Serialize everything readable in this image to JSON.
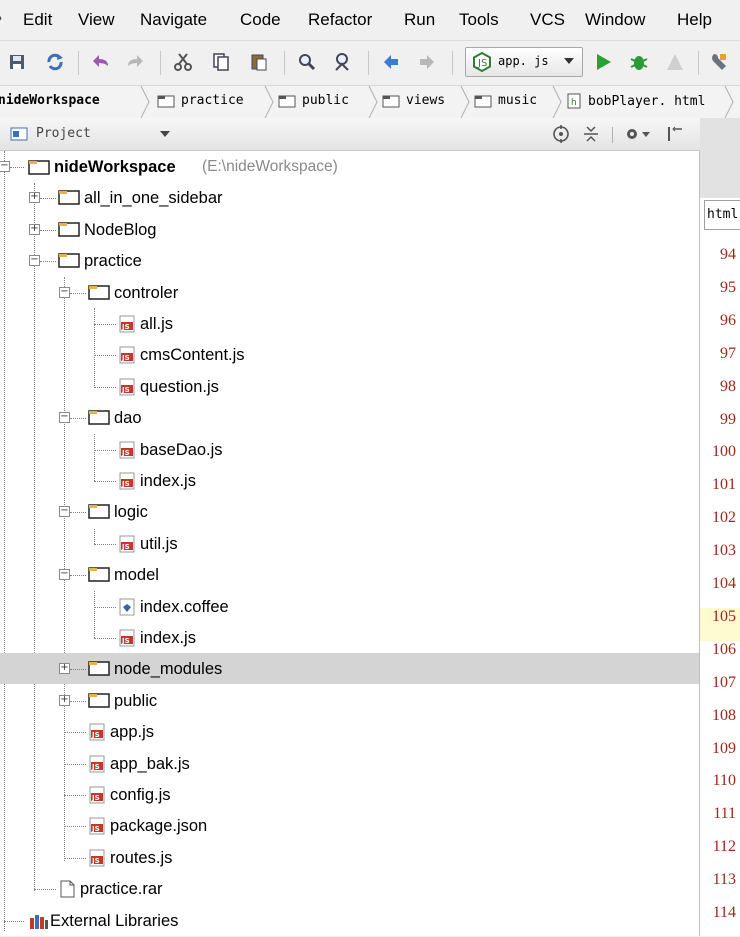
{
  "menu": [
    {
      "label": "Edit"
    },
    {
      "label": "View"
    },
    {
      "label": "Navigate"
    },
    {
      "label": "Code"
    },
    {
      "label": "Refactor"
    },
    {
      "label": "Run"
    },
    {
      "label": "Tools"
    },
    {
      "label": "VCS"
    },
    {
      "label": "Window"
    },
    {
      "label": "Help"
    }
  ],
  "toolbar": {
    "run_config": "app. js"
  },
  "breadcrumb": [
    "nideWorkspace",
    "practice",
    "public",
    "views",
    "music",
    "bobPlayer. html"
  ],
  "project_panel": {
    "title": "Project"
  },
  "tree": {
    "root_name": "nideWorkspace",
    "root_path": "(E:\\nideWorkspace)",
    "items": [
      {
        "name": "all_in_one_sidebar"
      },
      {
        "name": "NodeBlog"
      },
      {
        "name": "practice"
      },
      {
        "name": "controler"
      },
      {
        "name": "all.js"
      },
      {
        "name": "cmsContent.js"
      },
      {
        "name": "question.js"
      },
      {
        "name": "dao"
      },
      {
        "name": "baseDao.js"
      },
      {
        "name": "index.js"
      },
      {
        "name": "logic"
      },
      {
        "name": "util.js"
      },
      {
        "name": "model"
      },
      {
        "name": "index.coffee"
      },
      {
        "name": "index.js"
      },
      {
        "name": "node_modules"
      },
      {
        "name": "public"
      },
      {
        "name": "app.js"
      },
      {
        "name": "app_bak.js"
      },
      {
        "name": "config.js"
      },
      {
        "name": "package.json"
      },
      {
        "name": "routes.js"
      },
      {
        "name": "practice.rar"
      },
      {
        "name": "External Libraries"
      }
    ]
  },
  "editor": {
    "tab_label": "html",
    "line_numbers": [
      "94",
      "95",
      "96",
      "97",
      "98",
      "99",
      "100",
      "101",
      "102",
      "103",
      "104",
      "105",
      "106",
      "107",
      "108",
      "109",
      "110",
      "111",
      "112",
      "113",
      "114"
    ],
    "current_line": "105"
  },
  "colors": {
    "folder": "#e8b24a",
    "js_icon": "#c0392b",
    "selection": "#d4d4d4",
    "line_number": "#a0261a",
    "run_green": "#27a336"
  }
}
